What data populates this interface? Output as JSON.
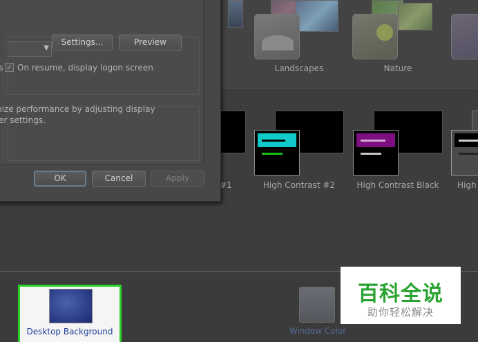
{
  "themes_top": [
    {
      "label": "Landscapes"
    },
    {
      "label": "Nature"
    }
  ],
  "themes_high_contrast": [
    {
      "label": "#1"
    },
    {
      "label": "High Contrast #2",
      "bar_color": "#12c9c9",
      "line_colors": [
        "#000000",
        "#19c219"
      ]
    },
    {
      "label": "High Contrast Black",
      "bar_color": "#7d0f80",
      "line_colors": [
        "#d3a9d6",
        "#c9c9c9"
      ]
    },
    {
      "label": "High"
    }
  ],
  "dialog": {
    "settings_label": "Settings...",
    "preview_label": "Preview",
    "wait_suffix": "es",
    "resume_label": "On resume, display logon screen",
    "power_line1": "mize performance by adjusting display",
    "power_line2": "ver settings.",
    "ok_label": "OK",
    "cancel_label": "Cancel",
    "apply_label": "Apply"
  },
  "bottom_bar": {
    "desktop_background_label": "Desktop Background",
    "window_color_label": "Window Color",
    "highlight_color": "#29d52a"
  },
  "watermark": {
    "title": "百科全说",
    "subtitle": "助你轻松解决"
  }
}
